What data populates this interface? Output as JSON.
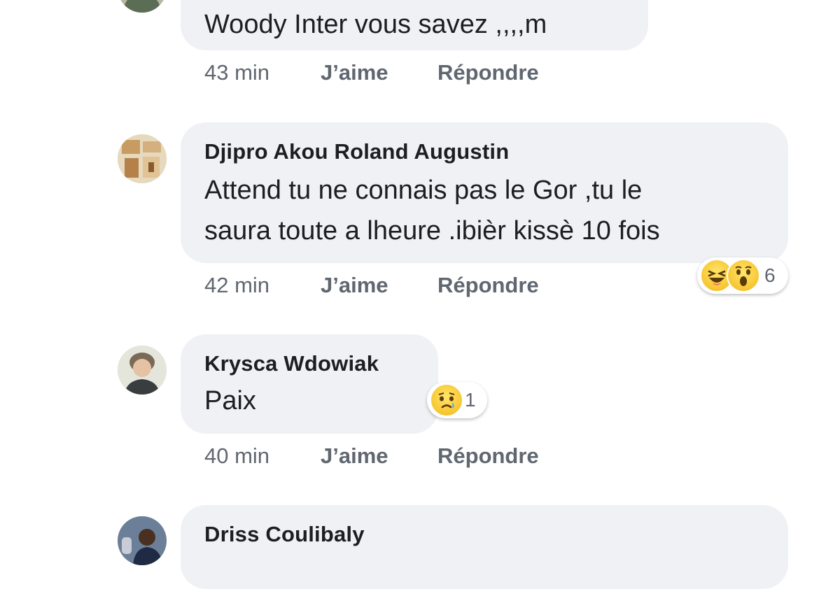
{
  "comments": [
    {
      "author": "",
      "text": "Woody Inter vous savez ,,,,m",
      "time": "43 min",
      "like_label": "J’aime",
      "reply_label": "Répondre"
    },
    {
      "author": "Djipro Akou Roland Augustin",
      "text": "Attend tu ne connais pas le Gor ,tu le\nsaura toute a lheure .ibièr kissè 10 fois",
      "time": "42 min",
      "like_label": "J’aime",
      "reply_label": "Répondre",
      "reactions": {
        "icons": [
          "haha-icon",
          "wow-icon"
        ],
        "count": "6"
      }
    },
    {
      "author": "Krysca Wdowiak",
      "text": "Paix",
      "time": "40 min",
      "like_label": "J’aime",
      "reply_label": "Répondre",
      "reactions": {
        "icons": [
          "sad-icon"
        ],
        "count": "1"
      }
    },
    {
      "author": "Driss Coulibaly",
      "text": ""
    }
  ]
}
